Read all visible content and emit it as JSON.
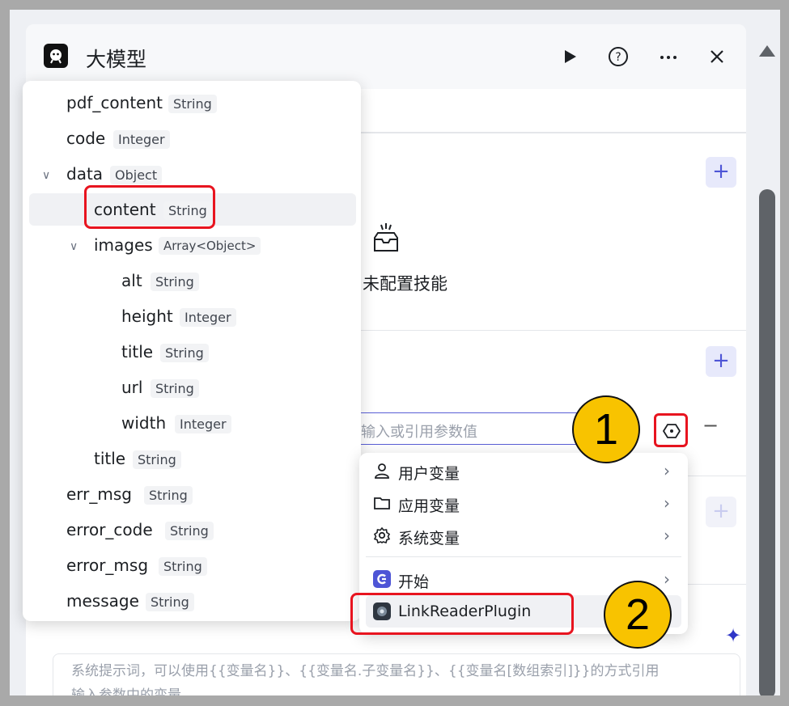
{
  "header": {
    "title": "大模型"
  },
  "skills": {
    "empty_text": "未配置技能",
    "empty_text_visible": "未配置技能"
  },
  "param": {
    "placeholder": "输入或引用参数值"
  },
  "tree": {
    "rows": [
      {
        "name": "pdf_content",
        "type": "String"
      },
      {
        "name": "code",
        "type": "Integer"
      },
      {
        "name": "data",
        "type": "Object"
      },
      {
        "name": "content",
        "type": "String"
      },
      {
        "name": "images",
        "type": "Array<Object>"
      },
      {
        "name": "alt",
        "type": "String"
      },
      {
        "name": "height",
        "type": "Integer"
      },
      {
        "name": "title",
        "type": "String"
      },
      {
        "name": "url",
        "type": "String"
      },
      {
        "name": "width",
        "type": "Integer"
      },
      {
        "name": "title",
        "type": "String"
      },
      {
        "name": "err_msg",
        "type": "String"
      },
      {
        "name": "error_code",
        "type": "String"
      },
      {
        "name": "error_msg",
        "type": "String"
      },
      {
        "name": "message",
        "type": "String"
      }
    ]
  },
  "menu": {
    "items": [
      {
        "label": "用户变量",
        "icon": "user-icon"
      },
      {
        "label": "应用变量",
        "icon": "folder-icon"
      },
      {
        "label": "系统变量",
        "icon": "gear-icon"
      },
      {
        "label": "开始",
        "icon": "start-icon"
      },
      {
        "label": "LinkReaderPlugin",
        "icon": "plugin-icon"
      }
    ]
  },
  "prompt": {
    "line1": "系统提示词，可以使用{{变量名}}、{{变量名.子变量名}}、{{变量名[数组索引]}}的方式引用",
    "line2": "输入参数中的变量"
  },
  "annotations": {
    "badge1": "1",
    "badge2": "2"
  },
  "colors": {
    "accent": "#4e55d6",
    "highlight": "#e8141f",
    "badge": "#f8c300"
  }
}
